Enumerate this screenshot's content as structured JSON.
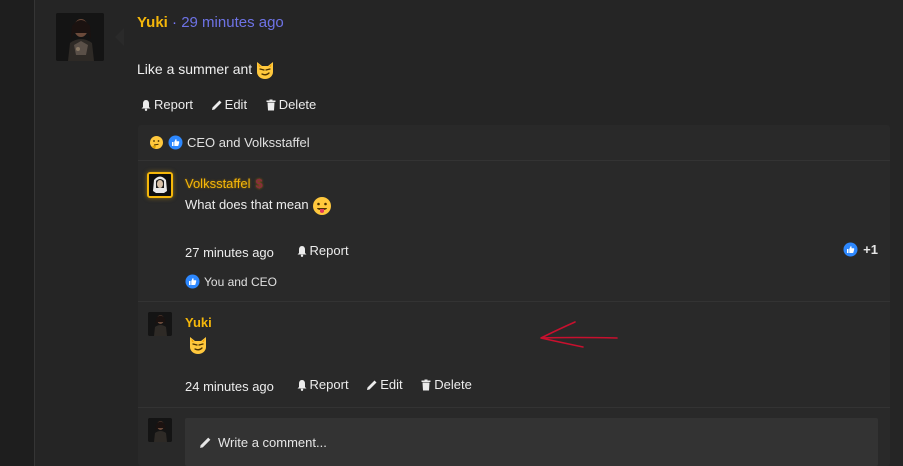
{
  "post": {
    "author": "Yuki",
    "separator": "·",
    "time": "29 minutes ago",
    "body": "Like a summer ant",
    "body_emoji": "smirking-cat-emoji",
    "actions": {
      "report": "Report",
      "edit": "Edit",
      "delete": "Delete"
    }
  },
  "reactions_summary": {
    "icons": [
      "thinking-face-emoji",
      "like-icon"
    ],
    "text": "CEO and Volksstaffel"
  },
  "replies": [
    {
      "author": "Volksstaffel",
      "badge": "$",
      "text": "What does that mean",
      "text_emoji": "tongue-face-emoji",
      "time": "27 minutes ago",
      "report": "Report",
      "like_count": "+1",
      "liked_by": "You and CEO"
    },
    {
      "author": "Yuki",
      "text": "",
      "text_emoji": "smirking-cat-emoji",
      "time": "24 minutes ago",
      "report": "Report",
      "edit": "Edit",
      "delete": "Delete"
    }
  ],
  "comment_box": {
    "placeholder": "Write a comment..."
  },
  "colors": {
    "username": "#f5b70a",
    "timestamp": "#6e73e6",
    "like_blue": "#2d88ff",
    "annotation_arrow": "#c8102e",
    "dollar_badge": "#8a2c3e"
  }
}
